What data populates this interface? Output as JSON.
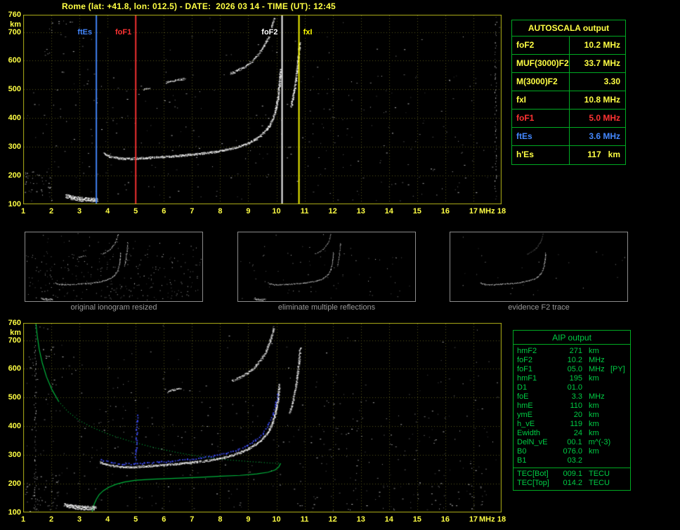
{
  "title": "Rome (lat: +41.8, lon: 012.5) - DATE:  2026 03 14 - TIME (UT): 12:45",
  "colors": {
    "axis": "#ffff44",
    "frame": "#b0b018",
    "grid": "#56561e",
    "panel_green": "#00aa22",
    "aip_text": "#00cc44",
    "profile_green": "#00b43c",
    "trace_blue": "#4050ff",
    "caption": "#9a9a9a",
    "yellow": "#ffff44",
    "red": "#ff3333",
    "blue": "#4488ff",
    "white": "#ffffff"
  },
  "autoscala": {
    "title": "AUTOSCALA output",
    "rows": [
      {
        "param": "foF2",
        "value": "10.2 MHz",
        "color": "yellow"
      },
      {
        "param": "MUF(3000)F2",
        "value": "33.7 MHz",
        "color": "yellow"
      },
      {
        "param": "M(3000)F2",
        "value": "3.30",
        "color": "yellow"
      },
      {
        "param": "fxI",
        "value": "10.8 MHz",
        "color": "yellow"
      },
      {
        "param": "foF1",
        "value": "5.0 MHz",
        "color": "red"
      },
      {
        "param": "ftEs",
        "value": "3.6 MHz",
        "color": "blue"
      },
      {
        "param": "h'Es",
        "value": "117   km",
        "color": "yellow"
      }
    ]
  },
  "aip": {
    "title": "AIP output",
    "rows": [
      {
        "name": "hmF2",
        "value": "271",
        "unit": "km",
        "note": ""
      },
      {
        "name": "foF2",
        "value": "10.2",
        "unit": "MHz",
        "note": ""
      },
      {
        "name": "foF1",
        "value": "05.0",
        "unit": "MHz",
        "note": "[PY]"
      },
      {
        "name": "hmF1",
        "value": "195",
        "unit": "km",
        "note": ""
      },
      {
        "name": "D1",
        "value": "01.0",
        "unit": "",
        "note": ""
      },
      {
        "name": "foE",
        "value": "3.3",
        "unit": "MHz",
        "note": ""
      },
      {
        "name": "hmE",
        "value": "110",
        "unit": "km",
        "note": ""
      },
      {
        "name": "ymE",
        "value": "20",
        "unit": "km",
        "note": ""
      },
      {
        "name": "h_vE",
        "value": "119",
        "unit": "km",
        "note": ""
      },
      {
        "name": "Ewidth",
        "value": "24",
        "unit": "km",
        "note": ""
      },
      {
        "name": "DelN_vE",
        "value": "00.1",
        "unit": "m^(-3)",
        "note": ""
      },
      {
        "name": "B0",
        "value": "076.0",
        "unit": "km",
        "note": ""
      },
      {
        "name": "B1",
        "value": "03.2",
        "unit": "",
        "note": ""
      }
    ],
    "tec_rows": [
      {
        "name": "TEC[Bot]",
        "value": "009.1",
        "unit": "TECU"
      },
      {
        "name": "TEC[Top]",
        "value": "014.2",
        "unit": "TECU"
      }
    ]
  },
  "thumbnails": [
    {
      "caption": "original ionogram resized",
      "render": {
        "noise": 290,
        "traces": [
          {
            "ref": "es"
          },
          {
            "ref": "f1"
          },
          {
            "ref": "fx"
          },
          {
            "ref": "f2nd"
          },
          {
            "ref": "patch"
          }
        ]
      }
    },
    {
      "caption": "eliminate multiple reflections",
      "render": {
        "noise": 70,
        "traces": [
          {
            "ref": "es"
          },
          {
            "ref": "f1"
          },
          {
            "ref": "fx",
            "alpha": 0.8
          },
          {
            "ref": "f2nd",
            "alpha": 0.8
          }
        ]
      }
    },
    {
      "caption": "evidence F2 trace",
      "render": {
        "noise": 25,
        "traces": [
          {
            "ref": "f1"
          },
          {
            "ref": "f2nd",
            "alpha": 0.45
          }
        ]
      }
    }
  ],
  "chart_data": [
    {
      "type": "scatter",
      "title": "scaled ionogram with characteristic frequencies",
      "xlabel": "MHz",
      "ylabel": "km",
      "xlim": [
        1,
        18
      ],
      "ylim": [
        100,
        760
      ],
      "grid": true,
      "x_ticks": [
        1,
        2,
        3,
        4,
        5,
        6,
        7,
        8,
        9,
        10,
        11,
        12,
        13,
        14,
        15,
        16,
        17,
        18
      ],
      "y_ticks": [
        760,
        700,
        600,
        500,
        400,
        300,
        200,
        100
      ],
      "markers": [
        {
          "label": "ftEs",
          "freq": 3.6,
          "color": "#4488ff",
          "side": "left"
        },
        {
          "label": "foF1",
          "freq": 5.0,
          "color": "#ff3333",
          "side": "left"
        },
        {
          "label": "foF2",
          "freq": 10.2,
          "color": "#ffffff",
          "side": "left"
        },
        {
          "label": "fxI",
          "freq": 10.8,
          "color": "#ffff00",
          "side": "right"
        }
      ],
      "traces": {
        "es": {
          "points": [
            [
              2.5,
              130
            ],
            [
              2.75,
              123
            ],
            [
              3.0,
              119
            ],
            [
              3.25,
              117
            ],
            [
              3.45,
              117
            ],
            [
              3.62,
              118
            ]
          ],
          "thickness": 6,
          "density": 4.5
        },
        "f1": {
          "points": [
            [
              3.85,
              278
            ],
            [
              4.05,
              268
            ],
            [
              4.3,
              262
            ],
            [
              4.6,
              259
            ],
            [
              4.95,
              260
            ],
            [
              5.35,
              262
            ],
            [
              5.8,
              265
            ],
            [
              6.3,
              268
            ],
            [
              6.8,
              272
            ],
            [
              7.3,
              277
            ],
            [
              7.8,
              283
            ],
            [
              8.2,
              290
            ],
            [
              8.6,
              300
            ],
            [
              8.95,
              312
            ],
            [
              9.25,
              327
            ],
            [
              9.5,
              346
            ],
            [
              9.7,
              369
            ],
            [
              9.85,
              396
            ],
            [
              9.97,
              434
            ],
            [
              10.05,
              478
            ],
            [
              10.1,
              526
            ],
            [
              10.13,
              570
            ]
          ],
          "thickness": 3,
          "density": 2.4
        },
        "fx": {
          "points": [
            [
              10.5,
              440
            ],
            [
              10.57,
              470
            ],
            [
              10.63,
              505
            ],
            [
              10.69,
              545
            ],
            [
              10.74,
              585
            ],
            [
              10.78,
              625
            ],
            [
              10.81,
              665
            ]
          ],
          "thickness": 2.5,
          "density": 2.0
        },
        "f2nd": {
          "points": [
            [
              8.35,
              556
            ],
            [
              8.6,
              566
            ],
            [
              8.9,
              582
            ],
            [
              9.15,
              602
            ],
            [
              9.35,
              624
            ],
            [
              9.55,
              652
            ],
            [
              9.7,
              682
            ],
            [
              9.82,
              716
            ],
            [
              9.9,
              750
            ]
          ],
          "thickness": 3,
          "density": 1.8
        },
        "patch": {
          "points": [
            [
              6.05,
              524
            ],
            [
              6.3,
              530
            ],
            [
              6.55,
              535
            ],
            [
              6.75,
              538
            ]
          ],
          "thickness": 2.5,
          "density": 1.6
        },
        "patch2": {
          "points": [
            [
              5.25,
              500
            ],
            [
              5.5,
              506
            ]
          ],
          "thickness": 2,
          "density": 1.4
        }
      },
      "noise": {
        "count": 330,
        "columns": [
          17.78
        ],
        "clusters": [
          {
            "f": [
              1.05,
              1.95
            ],
            "km": [
              100,
              215
            ],
            "count": 35
          },
          {
            "f": [
              1.6,
              3.4
            ],
            "km": [
              540,
              740
            ],
            "count": 20
          }
        ]
      }
    },
    {
      "type": "scatter",
      "title": "ionogram with restored trace and electron density profile",
      "xlabel": "MHz",
      "ylabel": "km",
      "xlim": [
        1,
        18
      ],
      "ylim": [
        100,
        760
      ],
      "grid": true,
      "x_ticks": [
        1,
        2,
        3,
        4,
        5,
        6,
        7,
        8,
        9,
        10,
        11,
        12,
        13,
        14,
        15,
        16,
        17,
        18
      ],
      "y_ticks": [
        760,
        700,
        600,
        500,
        400,
        300,
        200,
        100
      ],
      "traces": {
        "es": {
          "points": [
            [
              2.45,
              128
            ],
            [
              2.7,
              121
            ],
            [
              3.0,
              117
            ],
            [
              3.3,
              116
            ],
            [
              3.55,
              117
            ]
          ],
          "thickness": 6,
          "density": 4.5
        },
        "f1": {
          "points": [
            [
              3.7,
              276
            ],
            [
              3.95,
              267
            ],
            [
              4.25,
              261
            ],
            [
              4.6,
              258
            ],
            [
              4.95,
              259
            ],
            [
              5.4,
              262
            ],
            [
              5.9,
              265
            ],
            [
              6.4,
              269
            ],
            [
              6.9,
              274
            ],
            [
              7.4,
              279
            ],
            [
              7.85,
              286
            ],
            [
              8.25,
              295
            ],
            [
              8.6,
              306
            ],
            [
              8.95,
              320
            ],
            [
              9.25,
              337
            ],
            [
              9.5,
              357
            ],
            [
              9.7,
              381
            ],
            [
              9.85,
              411
            ],
            [
              9.96,
              450
            ],
            [
              10.04,
              495
            ],
            [
              10.09,
              545
            ]
          ],
          "thickness": 3,
          "density": 2.4
        },
        "fx": {
          "points": [
            [
              10.45,
              445
            ],
            [
              10.55,
              480
            ],
            [
              10.64,
              520
            ],
            [
              10.71,
              560
            ],
            [
              10.76,
              600
            ],
            [
              10.8,
              640
            ],
            [
              10.83,
              675
            ]
          ],
          "thickness": 2.5,
          "density": 1.8
        },
        "f2nd": {
          "points": [
            [
              8.4,
              558
            ],
            [
              8.65,
              568
            ],
            [
              8.95,
              585
            ],
            [
              9.2,
              605
            ],
            [
              9.4,
              628
            ],
            [
              9.58,
              655
            ],
            [
              9.72,
              685
            ],
            [
              9.83,
              718
            ],
            [
              9.9,
              745
            ]
          ],
          "thickness": 3,
          "density": 1.8
        },
        "patch": {
          "points": [
            [
              6.1,
              520
            ],
            [
              6.35,
              528
            ],
            [
              6.6,
              534
            ]
          ],
          "thickness": 2.5,
          "density": 1.5
        }
      },
      "blue_trace": {
        "segments": [
          [
            [
              3.75,
              285
            ],
            [
              4.1,
              276
            ],
            [
              4.5,
              271
            ],
            [
              4.9,
              271
            ],
            [
              5.3,
              274
            ],
            [
              5.8,
              277
            ],
            [
              6.3,
              281
            ],
            [
              6.8,
              286
            ],
            [
              7.3,
              292
            ],
            [
              7.8,
              299
            ],
            [
              8.2,
              308
            ],
            [
              8.6,
              320
            ],
            [
              8.95,
              335
            ],
            [
              9.25,
              354
            ],
            [
              9.5,
              377
            ],
            [
              9.7,
              407
            ],
            [
              9.85,
              442
            ],
            [
              9.95,
              477
            ],
            [
              10.02,
              512
            ]
          ],
          [
            [
              4.98,
              288
            ],
            [
              5.0,
              320
            ],
            [
              5.01,
              355
            ],
            [
              5.02,
              390
            ],
            [
              5.04,
              418
            ],
            [
              5.05,
              440
            ]
          ]
        ]
      },
      "profile": {
        "topside_solid": [
          [
            1.45,
            760
          ],
          [
            1.5,
            715
          ],
          [
            1.57,
            668
          ],
          [
            1.68,
            620
          ],
          [
            1.83,
            572
          ],
          [
            2.02,
            528
          ],
          [
            2.26,
            487
          ]
        ],
        "topside_dotted": [
          [
            2.26,
            487
          ],
          [
            2.6,
            450
          ],
          [
            3.0,
            420
          ],
          [
            3.5,
            394
          ],
          [
            4.1,
            370
          ],
          [
            4.8,
            348
          ],
          [
            5.6,
            327
          ],
          [
            6.5,
            308
          ],
          [
            7.4,
            293
          ],
          [
            8.3,
            283
          ],
          [
            9.2,
            276
          ],
          [
            9.8,
            272
          ],
          [
            10.15,
            271
          ]
        ],
        "bottomside": [
          [
            10.15,
            271
          ],
          [
            10.08,
            258
          ],
          [
            9.95,
            248
          ],
          [
            9.7,
            240
          ],
          [
            9.3,
            234
          ],
          [
            8.7,
            229
          ],
          [
            8.0,
            226
          ],
          [
            7.2,
            222
          ],
          [
            6.4,
            219
          ],
          [
            5.6,
            216
          ],
          [
            5.0,
            212
          ],
          [
            4.6,
            206
          ],
          [
            4.3,
            198
          ],
          [
            4.05,
            188
          ],
          [
            3.85,
            176
          ],
          [
            3.7,
            162
          ],
          [
            3.6,
            146
          ],
          [
            3.52,
            128
          ],
          [
            3.47,
            112
          ],
          [
            3.45,
            100
          ]
        ]
      },
      "noise": {
        "count": 400,
        "columns": [
          1.42
        ],
        "clusters": [
          {
            "f": [
              1.0,
              2.3
            ],
            "km": [
              100,
              235
            ],
            "count": 45
          },
          {
            "f": [
              1.2,
              3.2
            ],
            "km": [
              560,
              750
            ],
            "count": 28
          },
          {
            "f": [
              10.9,
              17.8
            ],
            "km": [
              100,
              200
            ],
            "count": 40
          }
        ]
      }
    }
  ]
}
